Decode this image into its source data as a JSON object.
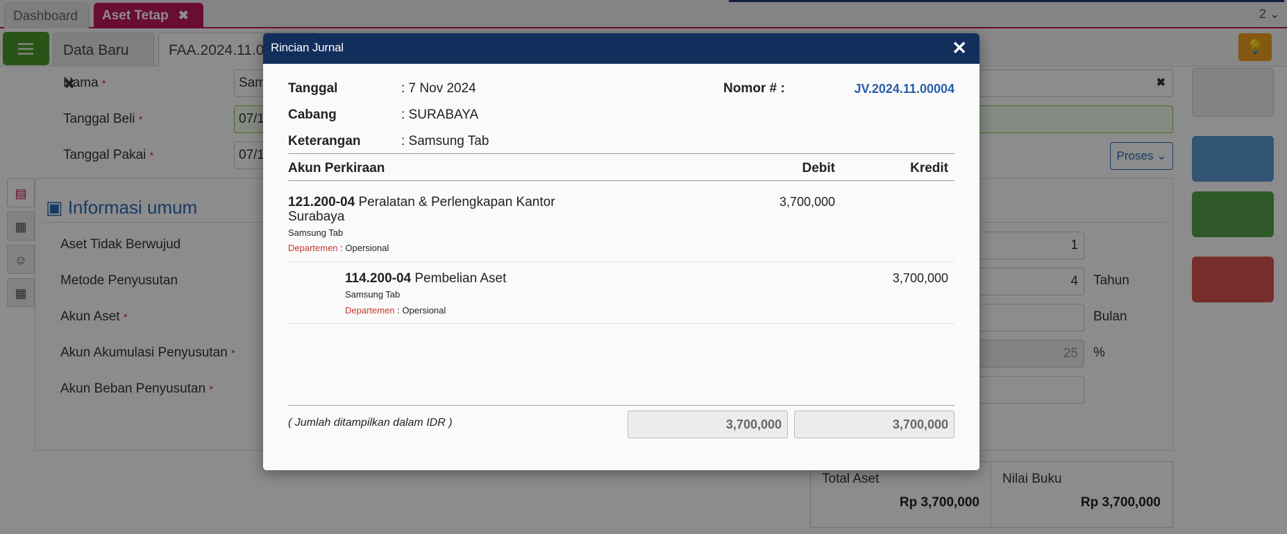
{
  "app": {
    "tabs_top": [
      {
        "label": "Dashboard"
      },
      {
        "label": "Aset Tetap"
      }
    ],
    "top_right": "2",
    "tabs_second": [
      {
        "label": "Data Baru"
      },
      {
        "label": "FAA.2024.11.00"
      }
    ],
    "form": {
      "nama_label": "Nama",
      "nama_value": "Sam",
      "tanggal_beli_label": "Tanggal Beli",
      "tanggal_beli_value": "07/1",
      "tanggal_pakai_label": "Tanggal Pakai",
      "tanggal_pakai_value": "07/1"
    },
    "panel": {
      "title": "Informasi umum",
      "fields": [
        {
          "label": "Aset Tidak Berwujud",
          "required": false
        },
        {
          "label": "Metode Penyusutan",
          "required": false
        },
        {
          "label": "Akun Aset",
          "required": true
        },
        {
          "label": "Akun Akumulasi Penyusutan",
          "required": true
        },
        {
          "label": "Akun Beban Penyusutan",
          "required": true
        }
      ],
      "right_values": [
        "1",
        "4",
        "",
        "25",
        ""
      ],
      "right_units": [
        "",
        "Tahun",
        "Bulan",
        "%",
        ""
      ]
    },
    "proses_label": "Proses",
    "totals": {
      "total_aset_label": "Total Aset",
      "total_aset_value": "Rp 3,700,000",
      "nilai_buku_label": "Nilai Buku",
      "nilai_buku_value": "Rp 3,700,000"
    }
  },
  "modal": {
    "title": "Rincian Jurnal",
    "tanggal_label": "Tanggal",
    "tanggal_value": ": 7 Nov 2024",
    "cabang_label": "Cabang",
    "cabang_value": ": SURABAYA",
    "keterangan_label": "Keterangan",
    "keterangan_value": ": Samsung Tab",
    "nomor_label": "Nomor # :",
    "nomor_value": "JV.2024.11.00004",
    "columns": {
      "akun": "Akun Perkiraan",
      "debit": "Debit",
      "kredit": "Kredit"
    },
    "lines": [
      {
        "code": "121.200-04",
        "name": "Peralatan & Perlengkapan Kantor Surabaya",
        "desc": "Samsung Tab",
        "dept_label": "Departemen",
        "dept_value": ": Opersional",
        "debit": "3,700,000",
        "kredit": ""
      },
      {
        "code": "114.200-04",
        "name": "Pembelian Aset",
        "desc": "Samsung Tab",
        "dept_label": "Departemen",
        "dept_value": ": Opersional",
        "debit": "",
        "kredit": "3,700,000"
      }
    ],
    "note": "( Jumlah ditampilkan dalam IDR )",
    "total_debit": "3,700,000",
    "total_kredit": "3,700,000"
  }
}
